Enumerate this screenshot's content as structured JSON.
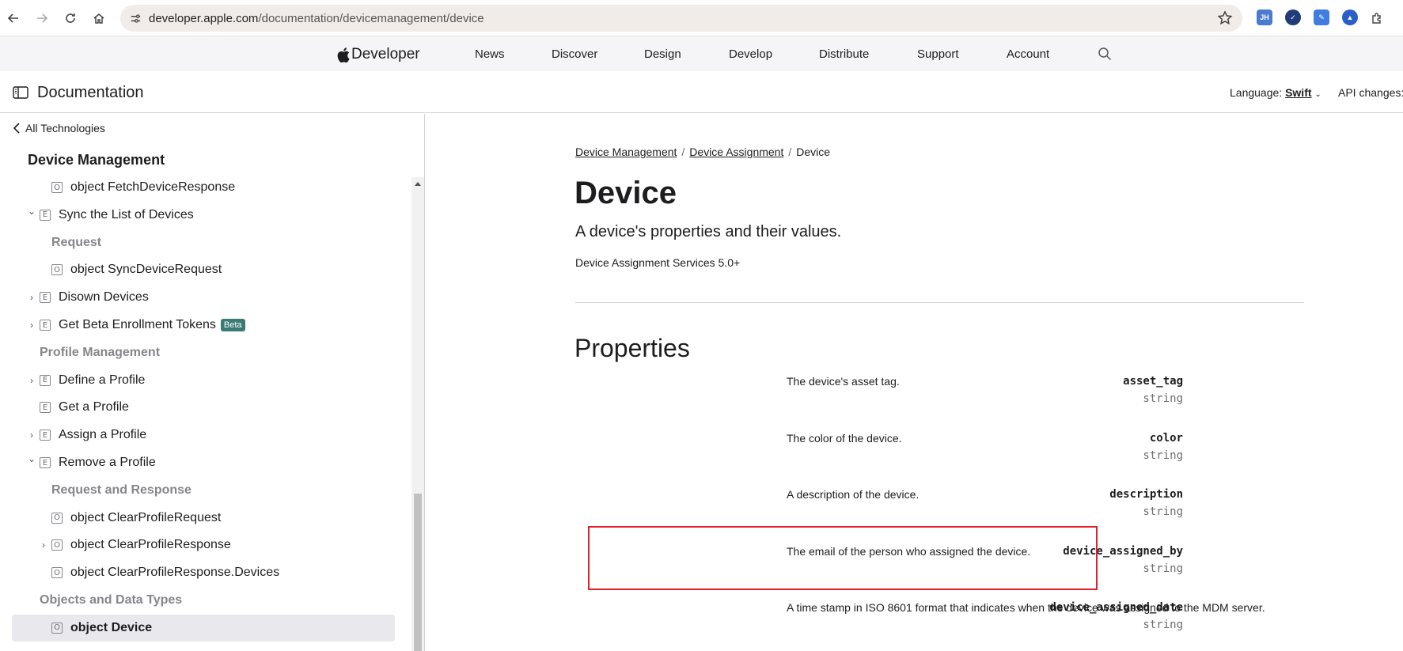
{
  "browser": {
    "url_domain": "developer.apple.com",
    "url_path": "/documentation/devicemanagement/device",
    "extensions": [
      {
        "name": "jh-extension-icon",
        "text": "JH",
        "color": "#4a7bd1"
      },
      {
        "name": "check-extension-icon",
        "text": "✓",
        "color": "#1f3b7a"
      },
      {
        "name": "pen-extension-icon",
        "text": "✎",
        "color": "#3f7de0"
      },
      {
        "name": "triangle-extension-icon",
        "text": "▲",
        "color": "#2b5fc7"
      }
    ]
  },
  "global_nav": {
    "brand": "Developer",
    "items": [
      "News",
      "Discover",
      "Design",
      "Develop",
      "Distribute",
      "Support",
      "Account"
    ]
  },
  "doc_header": {
    "title": "Documentation",
    "language_label": "Language:",
    "language_value": "Swift",
    "api_changes": "API changes:"
  },
  "sidebar": {
    "back_label": "All Technologies",
    "technology": "Device Management",
    "items": [
      {
        "kind": "item",
        "badge": "O",
        "label": "object FetchDeviceResponse"
      },
      {
        "kind": "item",
        "badge": "E",
        "label": "Sync the List of Devices",
        "chevron": "down"
      },
      {
        "kind": "group",
        "label": "Request"
      },
      {
        "kind": "item",
        "badge": "O",
        "label": "object SyncDeviceRequest"
      },
      {
        "kind": "item",
        "badge": "E",
        "label": "Disown Devices",
        "chevron": "right"
      },
      {
        "kind": "item",
        "badge": "E",
        "label": "Get Beta Enrollment Tokens",
        "chevron": "right",
        "tag": "Beta"
      },
      {
        "kind": "group",
        "label": "Profile Management"
      },
      {
        "kind": "item",
        "badge": "E",
        "label": "Define a Profile",
        "chevron": "right"
      },
      {
        "kind": "item",
        "badge": "E",
        "label": "Get a Profile"
      },
      {
        "kind": "item",
        "badge": "E",
        "label": "Assign a Profile",
        "chevron": "right"
      },
      {
        "kind": "item",
        "badge": "E",
        "label": "Remove a Profile",
        "chevron": "down"
      },
      {
        "kind": "group",
        "label": "Request and Response"
      },
      {
        "kind": "item",
        "badge": "O",
        "label": "object ClearProfileRequest"
      },
      {
        "kind": "item",
        "badge": "O",
        "label": "object ClearProfileResponse",
        "chevron": "right"
      },
      {
        "kind": "item",
        "badge": "O",
        "label": "object ClearProfileResponse.Devices"
      },
      {
        "kind": "group",
        "label": "Objects and Data Types"
      },
      {
        "kind": "item",
        "badge": "O",
        "label": "object Device",
        "selected": true
      }
    ]
  },
  "main": {
    "breadcrumbs": [
      "Device Management",
      "Device Assignment",
      "Device"
    ],
    "title": "Device",
    "abstract": "A device's properties and their values.",
    "availability": "Device Assignment Services 5.0+",
    "section_title": "Properties",
    "properties": [
      {
        "name": "asset_tag",
        "type": "string",
        "description": "The device's asset tag."
      },
      {
        "name": "color",
        "type": "string",
        "description": "The color of the device."
      },
      {
        "name": "description",
        "type": "string",
        "description": "A description of the device."
      },
      {
        "name": "device_assigned_by",
        "type": "string",
        "description": "The email of the person who assigned the device."
      },
      {
        "name": "device_assigned_date",
        "type": "string",
        "description": "A time stamp in ISO 8601 format that indicates when the device was assigned to the MDM server."
      }
    ],
    "highlight_color": "#e0202a"
  }
}
